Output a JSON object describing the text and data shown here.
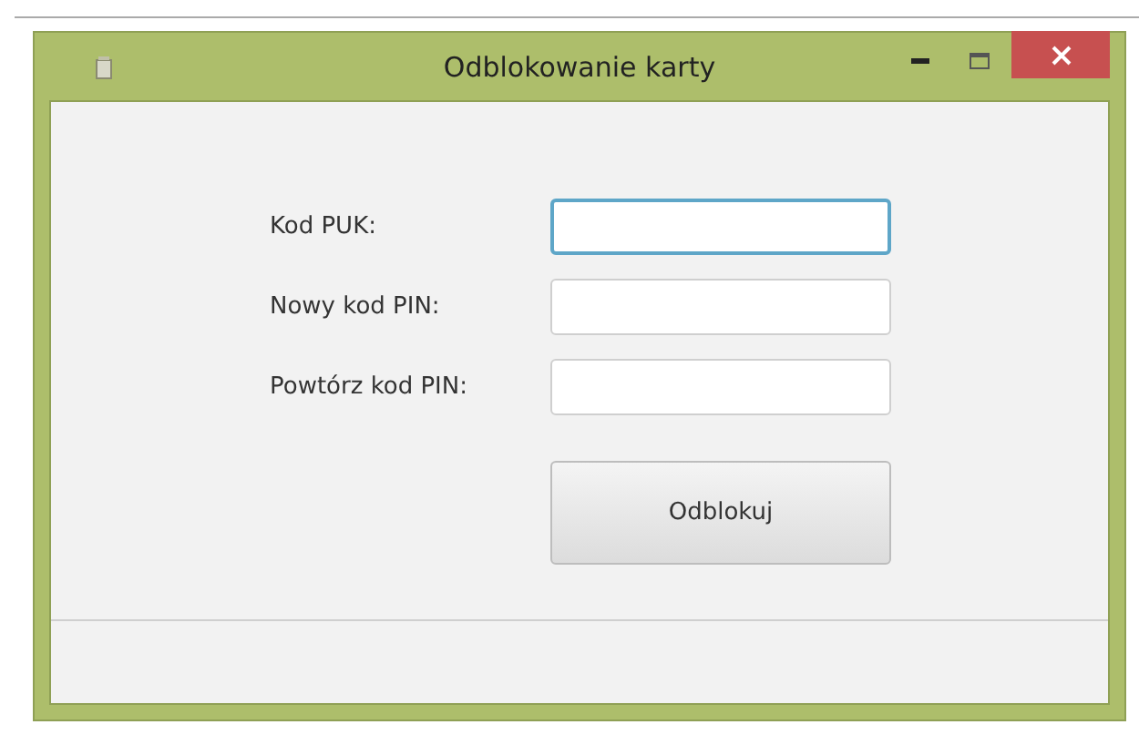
{
  "window": {
    "title": "Odblokowanie karty"
  },
  "fields": [
    {
      "label": "Kod PUK:",
      "focused": true
    },
    {
      "label": "Nowy kod PIN:",
      "focused": false
    },
    {
      "label": "Powtórz kod PIN:",
      "focused": false
    }
  ],
  "button": "Odblokuj"
}
